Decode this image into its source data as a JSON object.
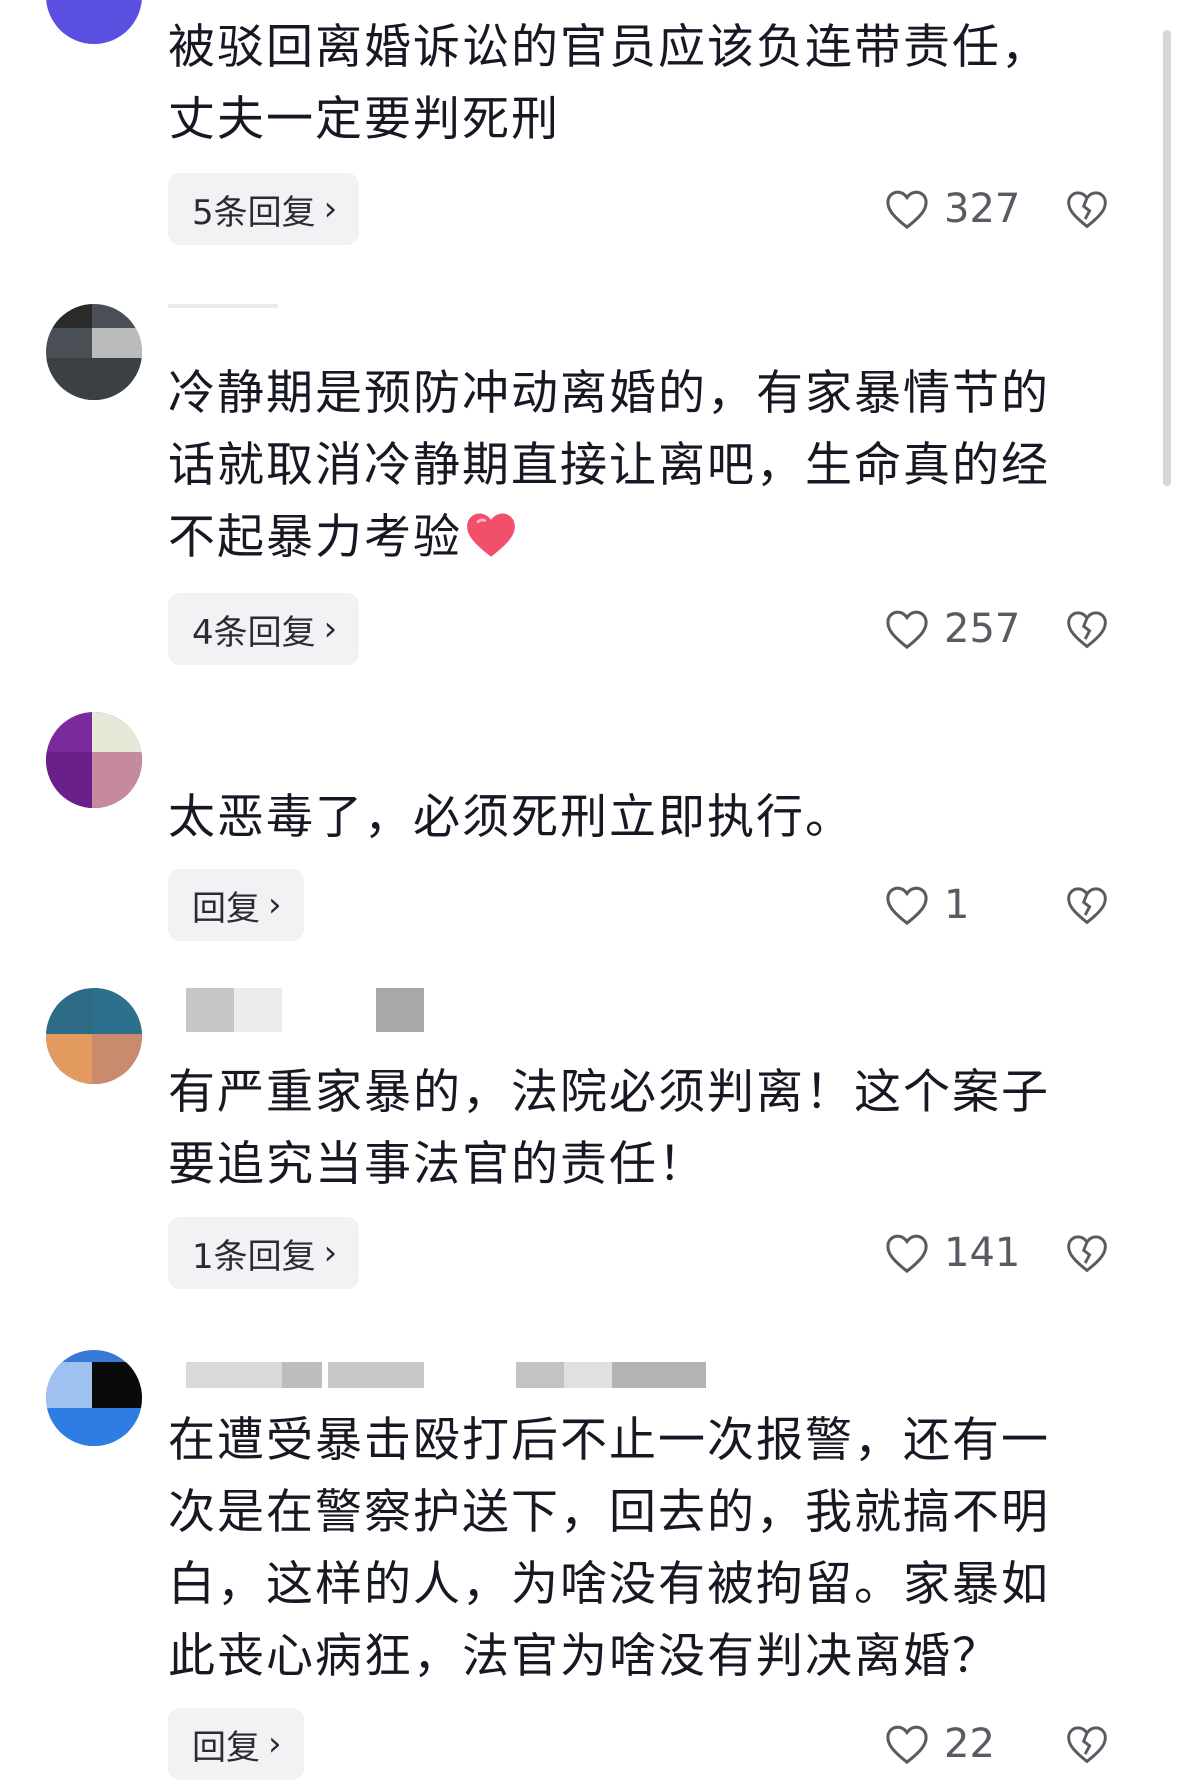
{
  "colors": {
    "text": "#161823",
    "reply_bg": "#f2f2f4",
    "meta_gray": "#5a5a63",
    "emoji_heart": "#f2506a"
  },
  "icons": {
    "like": "heart-outline-icon",
    "dislike": "broken-heart-outline-icon",
    "chevron": "chevron-right-icon",
    "emoji": "red-heart-emoji"
  },
  "comments": [
    {
      "text": "被驳回离婚诉讼的官员应该负连带责任，丈夫一定要判死刑",
      "reply_label": "5条回复",
      "likes": "327"
    },
    {
      "text": "冷静期是预防冲动离婚的，有家暴情节的话就取消冷静期直接让离吧，生命真的经不起暴力考验",
      "reply_label": "4条回复",
      "likes": "257"
    },
    {
      "text": "太恶毒了，必须死刑立即执行。",
      "reply_label": "回复",
      "likes": "1"
    },
    {
      "text": "有严重家暴的，法院必须判离！这个案子要追究当事法官的责任！",
      "reply_label": "1条回复",
      "likes": "141"
    },
    {
      "text": "在遭受暴击殴打后不止一次报警，还有一次是在警察护送下，回去的，我就搞不明白，这样的人，为啥没有被拘留。家暴如此丧心病狂，法官为啥没有判决离婚？",
      "reply_label": "回复",
      "likes": "22"
    }
  ]
}
